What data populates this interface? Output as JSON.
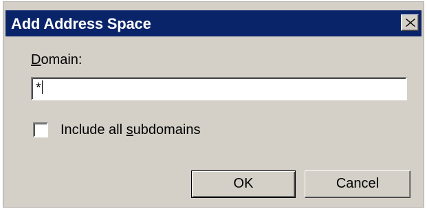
{
  "window": {
    "title": "Add Address Space",
    "close_icon": "close-icon",
    "title_bar_color": "#0a246a",
    "background_color": "#d4d0c8"
  },
  "form": {
    "domain_label_mnemonic": "D",
    "domain_label_rest": "omain:",
    "domain_value": "*",
    "include_subdomains_prefix": "Include all ",
    "include_subdomains_mnemonic": "s",
    "include_subdomains_rest": "ubdomains",
    "include_subdomains_checked": false
  },
  "buttons": {
    "ok_label": "OK",
    "cancel_label": "Cancel"
  }
}
